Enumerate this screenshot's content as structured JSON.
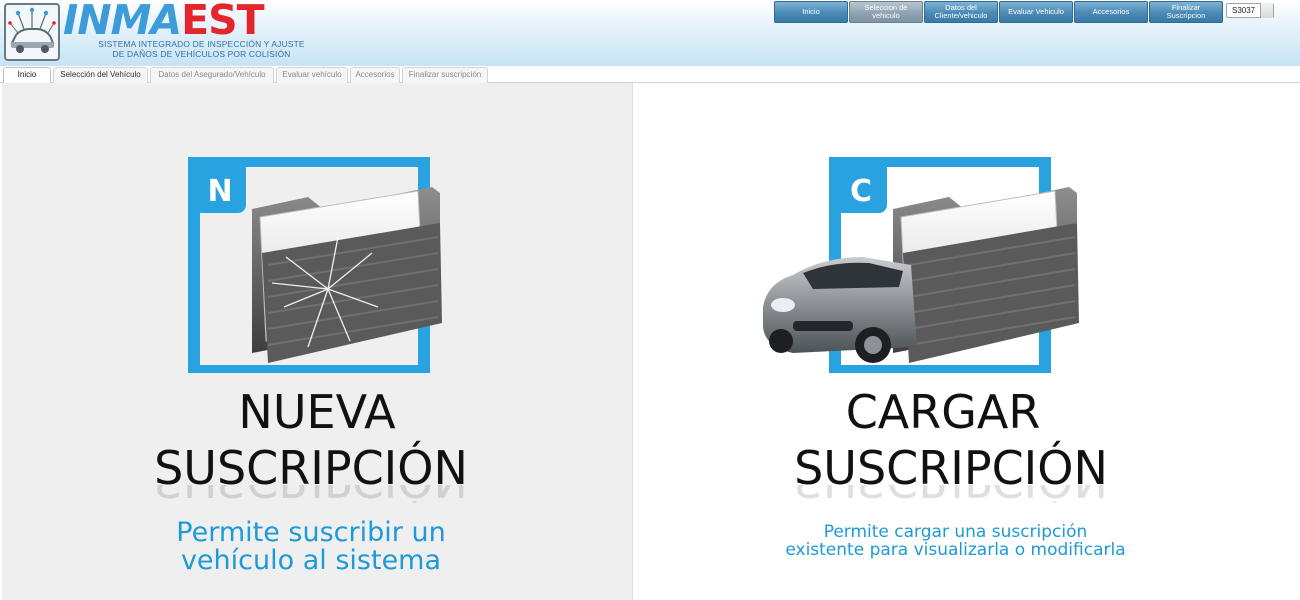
{
  "brand": {
    "name_part1": "INMA",
    "name_part2": "EST",
    "subtitle_line1": "SISTEMA INTEGRADO DE INSPECCIÓN Y AJUSTE",
    "subtitle_line2": "DE DAÑOS DE VEHÍCULOS POR COLISIÓN",
    "color_blue": "#3d9bd9",
    "color_red": "#e3262c"
  },
  "topnav": {
    "items": [
      {
        "label": "Inicio",
        "active": false
      },
      {
        "label": "Seleccion de vehiculo",
        "active": true
      },
      {
        "label": "Datos del Cliente/vehiculo",
        "active": false
      },
      {
        "label": "Evaluar Vehiculo",
        "active": false
      },
      {
        "label": "Accesorios",
        "active": false
      },
      {
        "label": "Finalizar Suscripcion",
        "active": false
      }
    ],
    "user_code": "S3037"
  },
  "tabs": [
    {
      "label": "Inicio",
      "state": "active"
    },
    {
      "label": "Selección del Vehículo",
      "state": "enabled"
    },
    {
      "label": "Datos del Asegurado/Vehículo",
      "state": "disabled"
    },
    {
      "label": "Evaluar vehículo",
      "state": "disabled"
    },
    {
      "label": "Accesorios",
      "state": "disabled"
    },
    {
      "label": "Finalizar suscripción",
      "state": "disabled"
    }
  ],
  "nueva": {
    "badge_letter": "N",
    "title_line1": "NUEVA",
    "title_line2": "SUSCRIPCIÓN",
    "desc_line1": "Permite suscribir un",
    "desc_line2": "vehículo al sistema"
  },
  "cargar": {
    "badge_letter": "C",
    "title_line1": "CARGAR",
    "title_line2": "SUSCRIPCIÓN",
    "desc_line1": "Permite cargar una suscripción",
    "desc_line2": "existente para visualizarla o modificarla"
  },
  "colors": {
    "accent_blue": "#1e9ad6",
    "nav_blue": "#4b89b5"
  }
}
